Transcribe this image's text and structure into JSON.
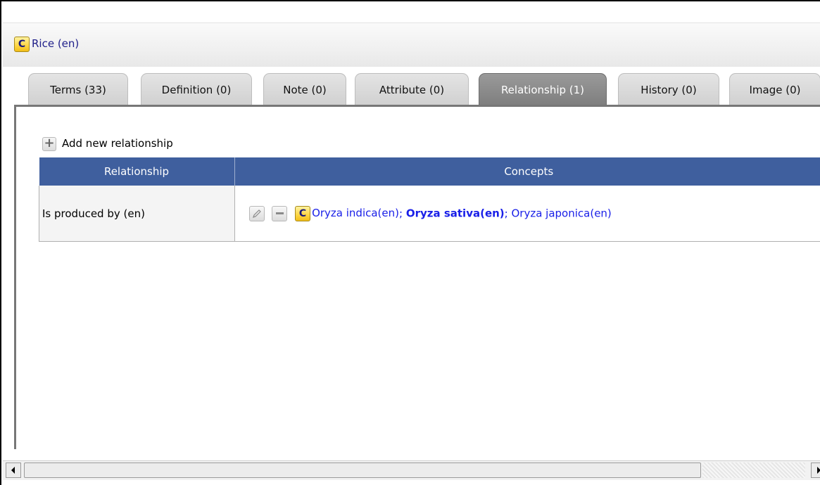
{
  "header": {
    "concept_badge": "C",
    "concept_title": "Rice (en)"
  },
  "tabs": [
    {
      "label": "Terms (33)",
      "active": false
    },
    {
      "label": "Definition (0)",
      "active": false
    },
    {
      "label": "Note (0)",
      "active": false
    },
    {
      "label": "Attribute  (0)",
      "active": false
    },
    {
      "label": "Relationship (1)",
      "active": true
    },
    {
      "label": "History (0)",
      "active": false
    },
    {
      "label": "Image (0)",
      "active": false
    }
  ],
  "toolbar": {
    "add_icon": "plus-icon",
    "add_label": "Add new relationship"
  },
  "table": {
    "columns": [
      "Relationship",
      "Concepts"
    ],
    "rows": [
      {
        "relationship": "Is produced by (en)",
        "concept_badge": "C",
        "concepts": [
          {
            "label": "Oryza indica(en)",
            "bold": false
          },
          {
            "label": "Oryza sativa(en)",
            "bold": true
          },
          {
            "label": "Oryza japonica(en)",
            "bold": false
          }
        ],
        "separator": "; "
      }
    ]
  },
  "colors": {
    "table_header_bg": "#3f5f9e",
    "active_tab_bg": "#8a8a8a",
    "link_color": "#1a20e8",
    "title_link_color": "#20208a",
    "badge_bg": "#ffd84a"
  }
}
